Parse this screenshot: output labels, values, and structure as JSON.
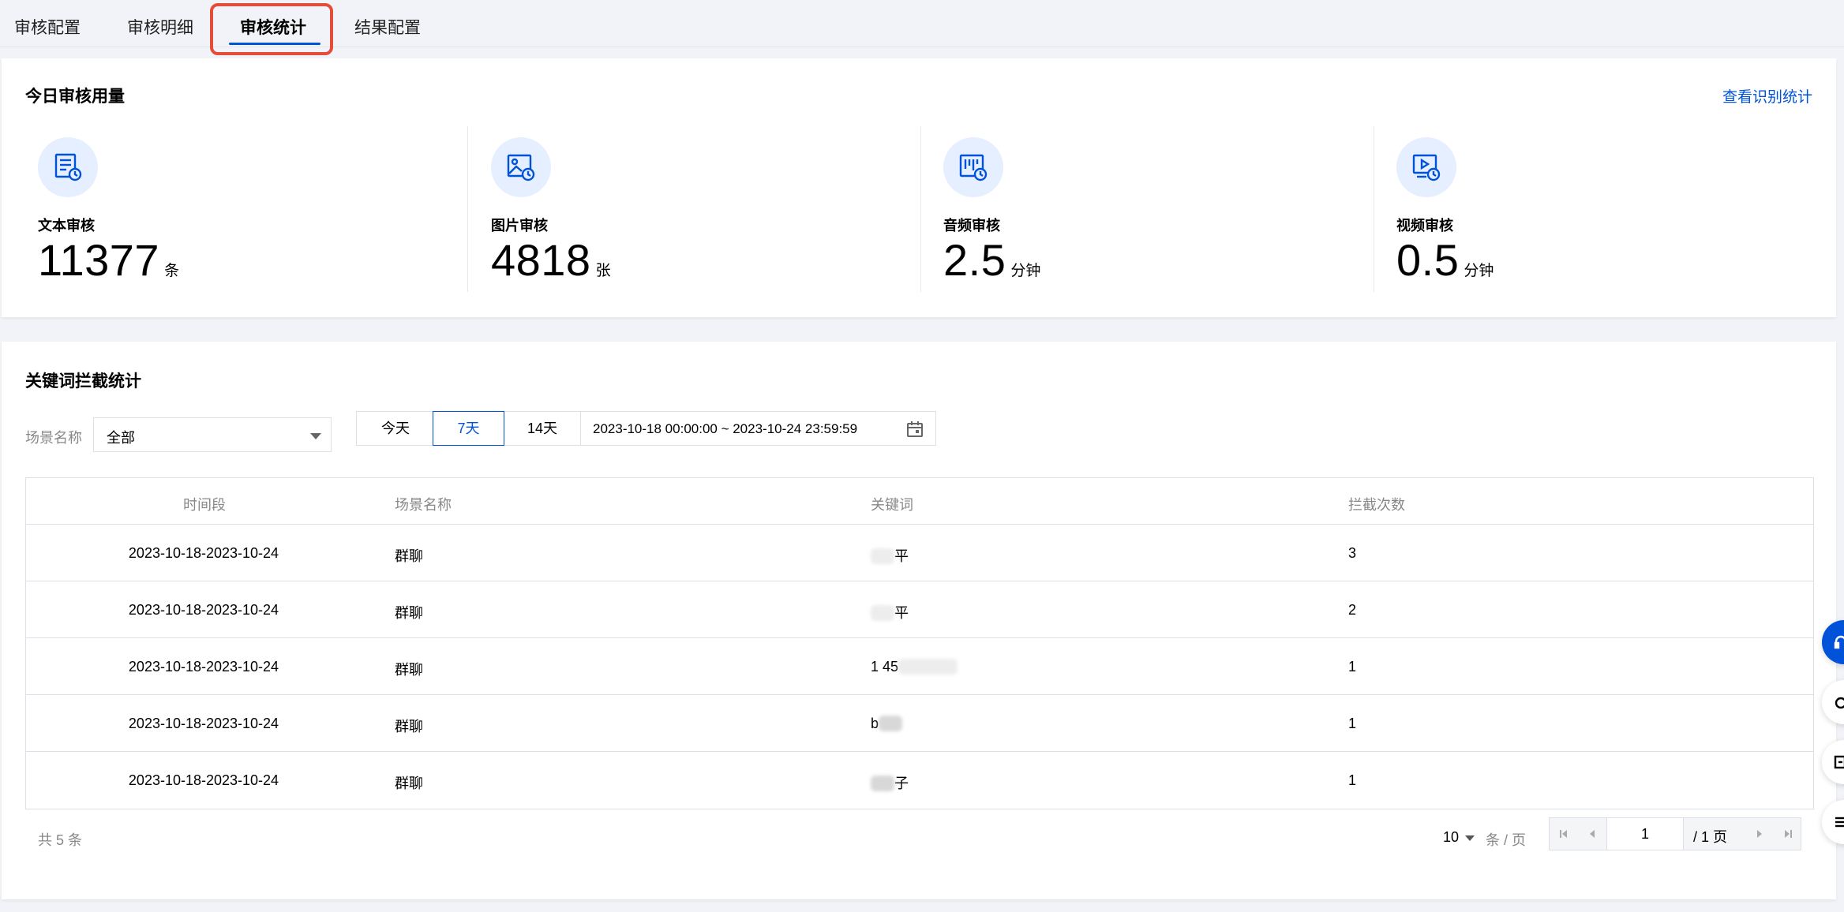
{
  "tabs": [
    {
      "label": "审核配置"
    },
    {
      "label": "审核明细"
    },
    {
      "label": "审核统计"
    },
    {
      "label": "结果配置"
    }
  ],
  "usage": {
    "title": "今日审核用量",
    "link": "查看识别统计",
    "stats": [
      {
        "label": "文本审核",
        "value": "11377",
        "unit": "条",
        "icon": "text-doc-clock-icon"
      },
      {
        "label": "图片审核",
        "value": "4818",
        "unit": "张",
        "icon": "image-clock-icon"
      },
      {
        "label": "音频审核",
        "value": "2.5",
        "unit": "分钟",
        "icon": "audio-clock-icon"
      },
      {
        "label": "视频审核",
        "value": "0.5",
        "unit": "分钟",
        "icon": "video-clock-icon"
      }
    ]
  },
  "keywords": {
    "title": "关键词拦截统计",
    "filter_label": "场景名称",
    "filter_value": "全部",
    "ranges": [
      "今天",
      "7天",
      "14天"
    ],
    "active_range": "7天",
    "date_range": "2023-10-18 00:00:00   ~ 2023-10-24 23:59:59",
    "columns": [
      "时间段",
      "场景名称",
      "关键词",
      "拦截次数"
    ],
    "rows": [
      {
        "period": "2023-10-18-2023-10-24",
        "scene": "群聊",
        "keyword": "平",
        "count": "3"
      },
      {
        "period": "2023-10-18-2023-10-24",
        "scene": "群聊",
        "keyword": "平",
        "count": "2"
      },
      {
        "period": "2023-10-18-2023-10-24",
        "scene": "群聊",
        "keyword": "1 45",
        "count": "1"
      },
      {
        "period": "2023-10-18-2023-10-24",
        "scene": "群聊",
        "keyword": "b",
        "count": "1"
      },
      {
        "period": "2023-10-18-2023-10-24",
        "scene": "群聊",
        "keyword": "子",
        "count": "1"
      }
    ],
    "total": "共 5 条",
    "page_size": "10",
    "page_unit": "条 / 页",
    "page": "1",
    "page_total": "/ 1 页"
  },
  "colors": {
    "accent": "#0052d9",
    "highlight": "#e34d3a",
    "icon_bg": "#e6efff"
  }
}
